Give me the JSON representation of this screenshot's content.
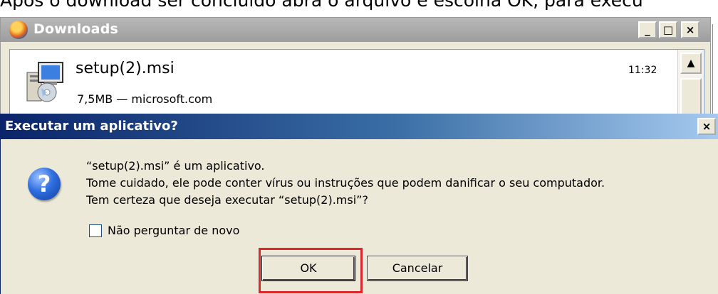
{
  "background": {
    "instruction_text": "Após o download ser concluído abra o arquivo e escolha OK, para execu"
  },
  "downloads_window": {
    "title": "Downloads",
    "controls": {
      "minimize": "_",
      "maximize": "□",
      "close": "×"
    },
    "item": {
      "filename": "setup(2).msi",
      "info": "7,5MB — microsoft.com",
      "time": "11:32"
    },
    "scroll_up": "▲"
  },
  "dialog": {
    "title": "Executar um aplicativo?",
    "close": "×",
    "question_icon": "?",
    "message_lines": [
      "“setup(2).msi” é um aplicativo.",
      "Tome cuidado, ele pode conter vírus ou instruções que podem danificar o seu computador.",
      "Tem certeza que deseja executar “setup(2).msi”?"
    ],
    "checkbox": {
      "label": "Não perguntar de novo",
      "checked": false
    },
    "buttons": {
      "ok": "OK",
      "cancel": "Cancelar"
    },
    "highlight_color": "#e1262b"
  },
  "colors": {
    "dialog_title_start": "#0a246a",
    "dialog_title_end": "#a6caf0",
    "window_face": "#ece9d8"
  }
}
